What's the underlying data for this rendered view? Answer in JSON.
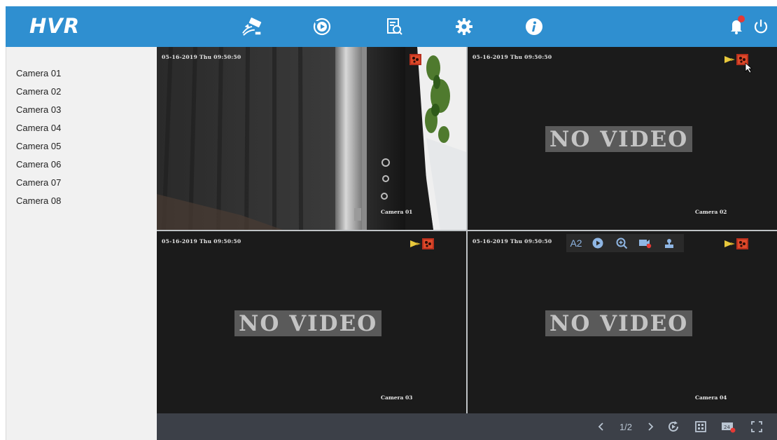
{
  "app": {
    "logo": "HVR"
  },
  "colors": {
    "topbar": "#2f8fd0",
    "notification_dot": "#e53935",
    "accent_icon": "#8fb6e4"
  },
  "topnav": {
    "items": [
      {
        "name": "live-view-icon",
        "label": ""
      },
      {
        "name": "playback-icon",
        "label": ""
      },
      {
        "name": "search-icon",
        "label": ""
      },
      {
        "name": "settings-icon",
        "label": ""
      },
      {
        "name": "info-icon",
        "label": ""
      }
    ]
  },
  "sidebar": {
    "cameras": [
      "Camera 01",
      "Camera 02",
      "Camera 03",
      "Camera 04",
      "Camera 05",
      "Camera 06",
      "Camera 07",
      "Camera 08"
    ]
  },
  "tiles": [
    {
      "timestamp": "05-16-2019 Thu 09:50:50",
      "name": "Camera 01",
      "no_video": ""
    },
    {
      "timestamp": "05-16-2019 Thu 09:50:50",
      "name": "Camera 02",
      "no_video": "NO VIDEO"
    },
    {
      "timestamp": "05-16-2019 Thu 09:50:50",
      "name": "Camera 03",
      "no_video": "NO VIDEO"
    },
    {
      "timestamp": "05-16-2019 Thu 09:50:50",
      "name": "Camera 04",
      "no_video": "NO VIDEO"
    }
  ],
  "tile_toolbar": {
    "stream_label": "A2"
  },
  "bottombar": {
    "page_indicator": "1/2"
  }
}
